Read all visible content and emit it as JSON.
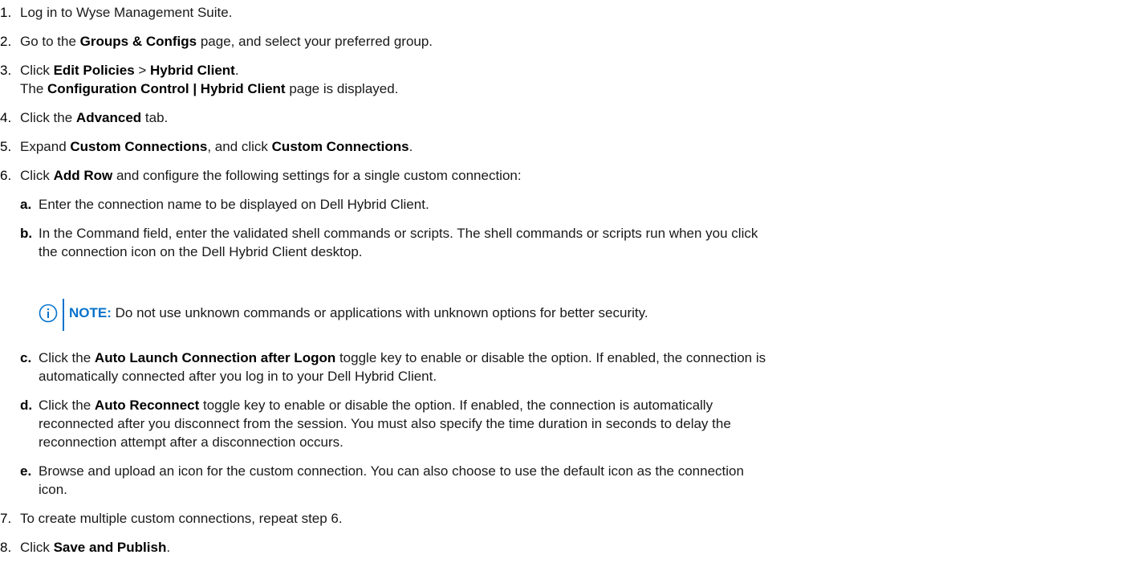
{
  "steps": [
    {
      "num": "1.",
      "parts": [
        "Log in to Wyse Management Suite."
      ]
    },
    {
      "num": "2.",
      "parts": [
        "Go to the ",
        "Groups & Configs",
        " page, and select your preferred group."
      ]
    },
    {
      "num": "3.",
      "parts": [
        "Click ",
        "Edit Policies",
        " > ",
        "Hybrid Client",
        "."
      ],
      "line2": [
        "The ",
        "Configuration Control | Hybrid Client",
        " page is displayed."
      ]
    },
    {
      "num": "4.",
      "parts": [
        "Click the ",
        "Advanced",
        " tab."
      ]
    },
    {
      "num": "5.",
      "parts": [
        "Expand ",
        "Custom Connections",
        ", and click ",
        "Custom Connections",
        "."
      ]
    },
    {
      "num": "6.",
      "parts": [
        "Click ",
        "Add Row",
        " and configure the following settings for a single custom connection:"
      ]
    },
    {
      "num": "7.",
      "parts": [
        "To create multiple custom connections, repeat step 6."
      ]
    },
    {
      "num": "8.",
      "parts": [
        "Click ",
        "Save and Publish",
        "."
      ]
    }
  ],
  "substeps": [
    {
      "letter": "a.",
      "parts": [
        "Enter the connection name to be displayed on Dell Hybrid Client."
      ]
    },
    {
      "letter": "b.",
      "line1": "In the Command field, enter the validated shell commands or scripts. The shell commands or scripts run when you click",
      "line2": "the connection icon on the Dell Hybrid Client desktop."
    },
    {
      "letter": "c.",
      "parts": [
        "Click the ",
        "Auto Launch Connection after Logon",
        " toggle key to enable or disable the option. If enabled, the connection is"
      ],
      "line2": "automatically connected after you log in to your Dell Hybrid Client."
    },
    {
      "letter": "d.",
      "parts": [
        "Click the ",
        "Auto Reconnect",
        " toggle key to enable or disable the option. If enabled, the connection is automatically"
      ],
      "line2": "reconnected after you disconnect from the session. You must also specify the time duration in seconds to delay the",
      "line3": "reconnection attempt after a disconnection occurs."
    },
    {
      "letter": "e.",
      "line1": "Browse and upload an icon for the custom connection. You can also choose to use the default icon as the connection",
      "line2": "icon."
    }
  ],
  "note": {
    "label": "NOTE:",
    "text": " Do not use unknown commands or applications with unknown options for better security.",
    "icon": "info-icon",
    "accent": "#0672cb"
  }
}
